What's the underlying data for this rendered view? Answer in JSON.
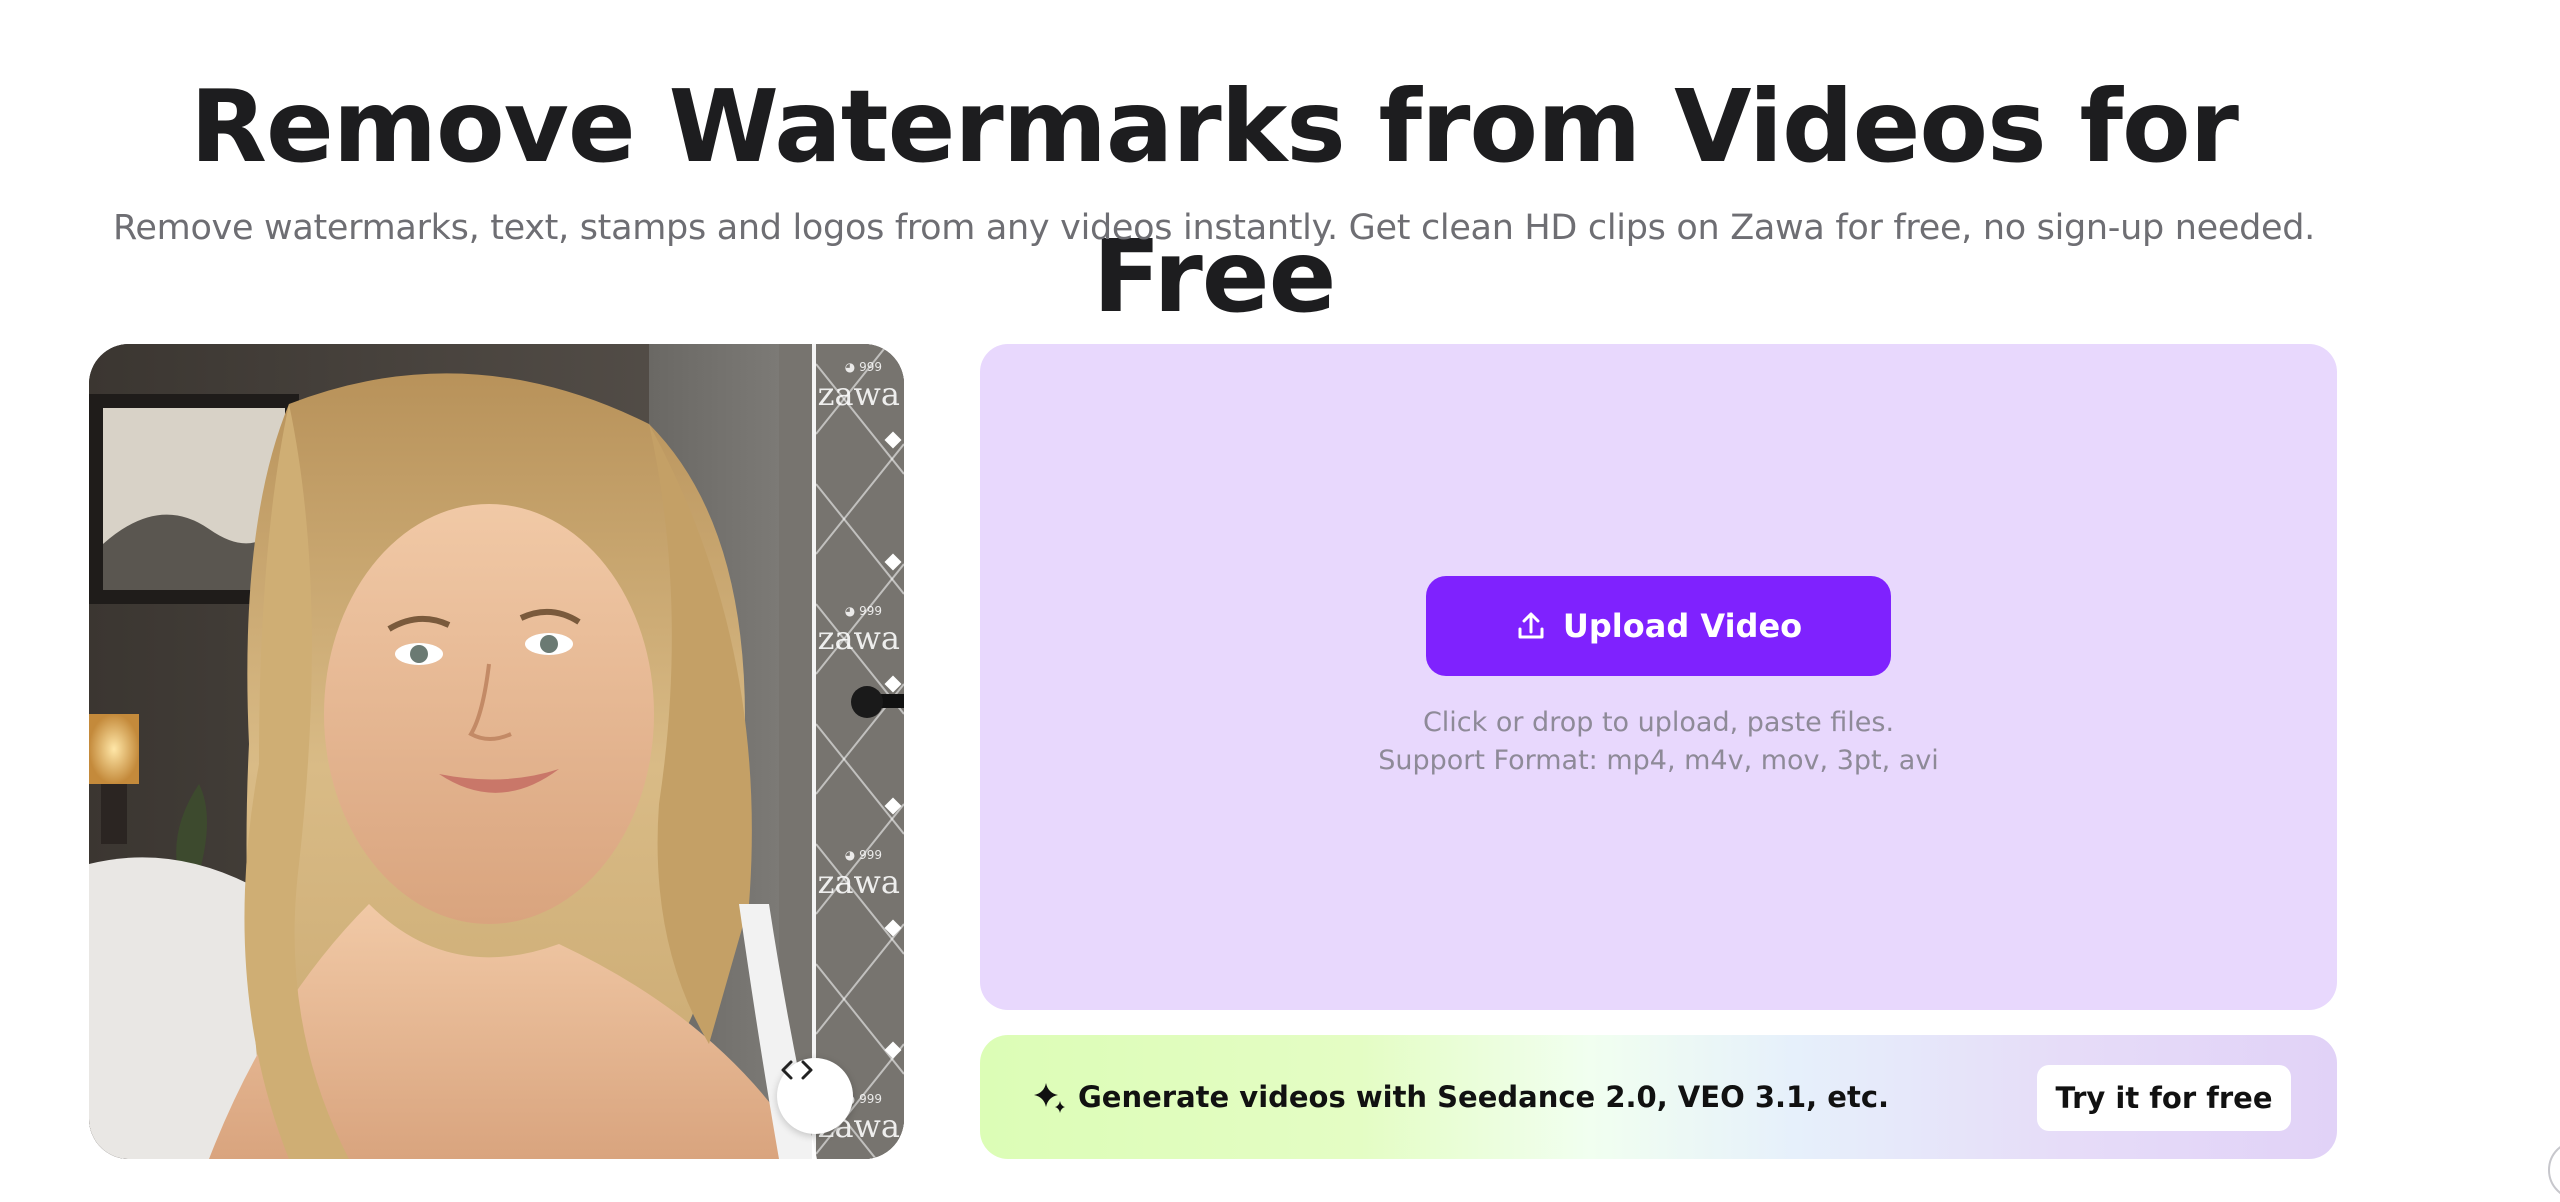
{
  "hero": {
    "title": "Remove Watermarks from Videos for Free",
    "subtitle": "Remove watermarks, text, stamps and logos from any videos instantly. Get clean HD clips on Zawa for free, no sign-up needed."
  },
  "comparison": {
    "watermark_text": "zawa",
    "watermark_badge": "◕ 999"
  },
  "upload": {
    "button_label": "Upload Video",
    "hint_line1": "Click or drop to upload, paste files.",
    "hint_line2": "Support Format: mp4, m4v, mov, 3pt, avi"
  },
  "promo": {
    "text": "Generate videos with Seedance 2.0, VEO 3.1, etc.",
    "button_label": "Try it for free"
  },
  "colors": {
    "accent": "#7f22fe",
    "upload_card_bg": "#e8d8fd",
    "title": "#1d1d1f",
    "subtitle": "#6e6e73"
  },
  "icons": {
    "upload": "upload-icon",
    "sparkle": "sparkle-icon",
    "compare_handle": "chevron-left-right-icon"
  }
}
